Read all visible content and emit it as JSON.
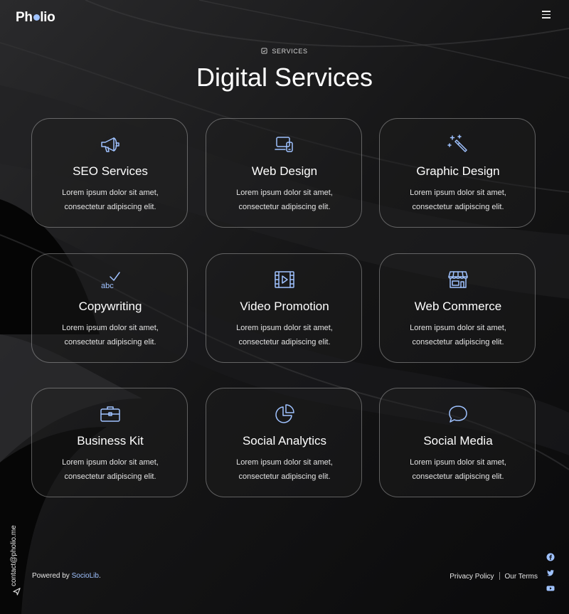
{
  "header": {
    "logo_text_left": "Ph",
    "logo_text_right": "lio"
  },
  "section": {
    "eyebrow": "SERVICES",
    "title": "Digital Services"
  },
  "services": [
    {
      "title": "SEO Services",
      "line1": "Lorem ipsum dolor sit amet,",
      "line2": "consectetur adipiscing elit.",
      "icon": "megaphone-icon"
    },
    {
      "title": "Web Design",
      "line1": "Lorem ipsum dolor sit amet,",
      "line2": "consectetur adipiscing elit.",
      "icon": "devices-icon"
    },
    {
      "title": "Graphic Design",
      "line1": "Lorem ipsum dolor sit amet,",
      "line2": "consectetur adipiscing elit.",
      "icon": "magic-wand-icon"
    },
    {
      "title": "Copywriting",
      "line1": "Lorem ipsum dolor sit amet,",
      "line2": "consectetur adipiscing elit.",
      "icon": "spellcheck-icon"
    },
    {
      "title": "Video Promotion",
      "line1": "Lorem ipsum dolor sit amet,",
      "line2": "consectetur adipiscing elit.",
      "icon": "film-icon"
    },
    {
      "title": "Web Commerce",
      "line1": "Lorem ipsum dolor sit amet,",
      "line2": "consectetur adipiscing elit.",
      "icon": "shop-icon"
    },
    {
      "title": "Business Kit",
      "line1": "Lorem ipsum dolor sit amet,",
      "line2": "consectetur adipiscing elit.",
      "icon": "briefcase-icon"
    },
    {
      "title": "Social Analytics",
      "line1": "Lorem ipsum dolor sit amet,",
      "line2": "consectetur adipiscing elit.",
      "icon": "pie-chart-icon"
    },
    {
      "title": "Social Media",
      "line1": "Lorem ipsum dolor sit amet,",
      "line2": "consectetur adipiscing elit.",
      "icon": "chat-bubble-icon"
    }
  ],
  "contact": {
    "email": "contact@pholio.me"
  },
  "footer": {
    "powered_prefix": "Powered by",
    "powered_link": "SocioLib",
    "powered_suffix": ".",
    "privacy": "Privacy Policy",
    "terms": "Our Terms"
  },
  "social": [
    "facebook-icon",
    "twitter-icon",
    "youtube-icon"
  ],
  "colors": {
    "accent": "#9fc2ff",
    "background": "#0d0d0e",
    "card_border": "#5a5a5c"
  }
}
